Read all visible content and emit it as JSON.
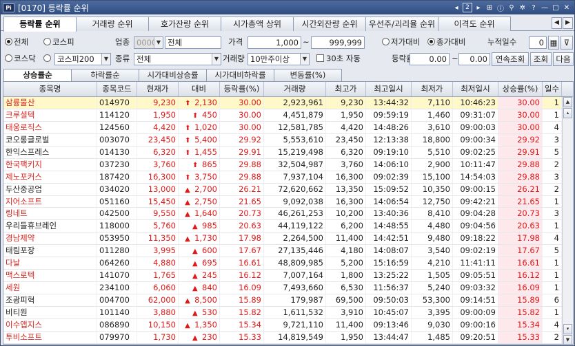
{
  "window": {
    "code_bracket": "[0170]",
    "title": "등락률 순위",
    "logo": "Pi",
    "page_num": "2"
  },
  "tabs": [
    "등락률 순위",
    "거래량 순위",
    "호가잔량 순위",
    "시가총액 상위",
    "시간외잔량 순위",
    "우선주/괴리율 순위",
    "이격도 순위"
  ],
  "filters": {
    "market_all": "전체",
    "kospi": "코스피",
    "kosdaq": "코스닥",
    "kospi200": "코스피200",
    "sector_label": "업종",
    "sector_code": "0000",
    "sector_value": "전체",
    "price_label": "가격",
    "price_min": "1,000",
    "price_sep": "~",
    "price_max": "999,999",
    "vs_low": "저가대비",
    "vs_close": "종가대비",
    "cum_days_label": "누적일수",
    "cum_days": "0",
    "type_label": "종류",
    "type_value": "전체",
    "volume_label": "거래량",
    "volume_value": "10만주이상",
    "auto_label": "30초 자동",
    "rate_label": "등락률",
    "rate_min": "0.00",
    "rate_sep": "~",
    "rate_max": "0.00",
    "btn_continuous": "연속조회",
    "btn_query": "조회",
    "btn_next": "다음"
  },
  "subtabs": [
    "상승률순",
    "하락률순",
    "시가대비상승률",
    "시가대비하락률",
    "변동률(%)"
  ],
  "columns": [
    "종목명",
    "종목코드",
    "현재가",
    "대비",
    "등락률(%)",
    "거래량",
    "최고가",
    "최고일시",
    "최저가",
    "최저일시",
    "상승률(%)",
    "일수"
  ],
  "rows": [
    {
      "name": "삼륭물산",
      "code": "014970",
      "price": "9,230",
      "arrow": "⬆",
      "diff": "2,130",
      "rate": "30.00",
      "volume": "2,923,961",
      "high": "9,230",
      "high_time": "13:44:32",
      "low": "7,110",
      "low_time": "10:46:23",
      "up_rate": "30.00",
      "days": "1",
      "name_red": true,
      "sel": true
    },
    {
      "name": "크루셜텍",
      "code": "114120",
      "price": "1,950",
      "arrow": "⬆",
      "diff": "450",
      "rate": "30.00",
      "volume": "4,451,879",
      "high": "1,950",
      "high_time": "09:59:19",
      "low": "1,460",
      "low_time": "09:31:07",
      "up_rate": "30.00",
      "days": "1",
      "name_red": true
    },
    {
      "name": "태웅로직스",
      "code": "124560",
      "price": "4,420",
      "arrow": "⬆",
      "diff": "1,020",
      "rate": "30.00",
      "volume": "12,581,785",
      "high": "4,420",
      "high_time": "14:48:26",
      "low": "3,610",
      "low_time": "09:00:03",
      "up_rate": "30.00",
      "days": "4",
      "name_red": true
    },
    {
      "name": "코오롱글로벌",
      "code": "003070",
      "price": "23,450",
      "arrow": "⬆",
      "diff": "5,400",
      "rate": "29.92",
      "volume": "5,553,610",
      "high": "23,450",
      "high_time": "12:13:38",
      "low": "18,800",
      "low_time": "09:00:34",
      "up_rate": "29.92",
      "days": "3",
      "name_red": false
    },
    {
      "name": "한익스프레스",
      "code": "014130",
      "price": "6,320",
      "arrow": "⬆",
      "diff": "1,455",
      "rate": "29.91",
      "volume": "15,219,498",
      "high": "6,320",
      "high_time": "09:19:10",
      "low": "5,510",
      "low_time": "09:02:25",
      "up_rate": "29.91",
      "days": "5",
      "name_red": false
    },
    {
      "name": "한국팩키지",
      "code": "037230",
      "price": "3,760",
      "arrow": "⬆",
      "diff": "865",
      "rate": "29.88",
      "volume": "32,504,987",
      "high": "3,760",
      "high_time": "14:06:10",
      "low": "2,900",
      "low_time": "10:11:47",
      "up_rate": "29.88",
      "days": "2",
      "name_red": true
    },
    {
      "name": "제노포커스",
      "code": "187420",
      "price": "16,300",
      "arrow": "⬆",
      "diff": "3,750",
      "rate": "29.88",
      "volume": "7,937,104",
      "high": "16,300",
      "high_time": "09:02:39",
      "low": "15,100",
      "low_time": "14:54:03",
      "up_rate": "29.88",
      "days": "3",
      "name_red": true
    },
    {
      "name": "두산중공업",
      "code": "034020",
      "price": "13,000",
      "arrow": "▲",
      "diff": "2,700",
      "rate": "26.21",
      "volume": "72,620,662",
      "high": "13,350",
      "high_time": "15:09:52",
      "low": "10,350",
      "low_time": "09:00:15",
      "up_rate": "26.21",
      "days": "2",
      "name_red": false
    },
    {
      "name": "지어소프트",
      "code": "051160",
      "price": "15,450",
      "arrow": "▲",
      "diff": "2,750",
      "rate": "21.65",
      "volume": "9,092,038",
      "high": "16,300",
      "high_time": "14:06:54",
      "low": "12,750",
      "low_time": "09:42:21",
      "up_rate": "21.65",
      "days": "1",
      "name_red": true
    },
    {
      "name": "링네트",
      "code": "042500",
      "price": "9,550",
      "arrow": "▲",
      "diff": "1,640",
      "rate": "20.73",
      "volume": "46,261,253",
      "high": "10,200",
      "high_time": "13:40:36",
      "low": "8,410",
      "low_time": "09:04:28",
      "up_rate": "20.73",
      "days": "3",
      "name_red": true
    },
    {
      "name": "우리들휴브레인",
      "code": "118000",
      "price": "5,760",
      "arrow": "▲",
      "diff": "985",
      "rate": "20.63",
      "volume": "44,119,122",
      "high": "6,200",
      "high_time": "14:48:55",
      "low": "4,480",
      "low_time": "09:04:56",
      "up_rate": "20.63",
      "days": "1",
      "name_red": false
    },
    {
      "name": "경남제약",
      "code": "053950",
      "price": "11,350",
      "arrow": "▲",
      "diff": "1,730",
      "rate": "17.98",
      "volume": "2,264,500",
      "high": "11,400",
      "high_time": "14:42:51",
      "low": "9,480",
      "low_time": "09:18:22",
      "up_rate": "17.98",
      "days": "4",
      "name_red": true
    },
    {
      "name": "태림포장",
      "code": "011280",
      "price": "3,995",
      "arrow": "▲",
      "diff": "600",
      "rate": "17.67",
      "volume": "27,135,446",
      "high": "4,180",
      "high_time": "14:08:07",
      "low": "3,540",
      "low_time": "09:02:19",
      "up_rate": "17.67",
      "days": "5",
      "name_red": false
    },
    {
      "name": "다날",
      "code": "064260",
      "price": "4,880",
      "arrow": "▲",
      "diff": "695",
      "rate": "16.61",
      "volume": "48,809,985",
      "high": "5,200",
      "high_time": "15:16:59",
      "low": "4,210",
      "low_time": "11:41:11",
      "up_rate": "16.61",
      "days": "1",
      "name_red": true
    },
    {
      "name": "맥스로텍",
      "code": "141070",
      "price": "1,765",
      "arrow": "▲",
      "diff": "245",
      "rate": "16.12",
      "volume": "7,007,164",
      "high": "1,800",
      "high_time": "13:25:22",
      "low": "1,505",
      "low_time": "09:05:51",
      "up_rate": "16.12",
      "days": "1",
      "name_red": true
    },
    {
      "name": "세원",
      "code": "234100",
      "price": "6,060",
      "arrow": "▲",
      "diff": "840",
      "rate": "16.09",
      "volume": "7,493,660",
      "high": "6,530",
      "high_time": "11:56:37",
      "low": "5,240",
      "low_time": "09:03:32",
      "up_rate": "16.09",
      "days": "1",
      "name_red": true
    },
    {
      "name": "조광피혁",
      "code": "004700",
      "price": "62,000",
      "arrow": "▲",
      "diff": "8,500",
      "rate": "15.89",
      "volume": "179,987",
      "high": "69,500",
      "high_time": "09:50:03",
      "low": "53,300",
      "low_time": "09:14:51",
      "up_rate": "15.89",
      "days": "6",
      "name_red": false
    },
    {
      "name": "비티원",
      "code": "101140",
      "price": "3,880",
      "arrow": "▲",
      "diff": "530",
      "rate": "15.82",
      "volume": "1,611,532",
      "high": "3,910",
      "high_time": "10:45:07",
      "low": "3,395",
      "low_time": "09:00:09",
      "up_rate": "15.82",
      "days": "1",
      "name_red": false
    },
    {
      "name": "이수앱지스",
      "code": "086890",
      "price": "10,150",
      "arrow": "▲",
      "diff": "1,350",
      "rate": "15.34",
      "volume": "9,721,110",
      "high": "11,400",
      "high_time": "09:13:46",
      "low": "9,030",
      "low_time": "09:00:16",
      "up_rate": "15.34",
      "days": "4",
      "name_red": true
    },
    {
      "name": "투비소프트",
      "code": "079970",
      "price": "1,730",
      "arrow": "▲",
      "diff": "230",
      "rate": "15.33",
      "volume": "14,819,549",
      "high": "1,950",
      "high_time": "13:44:47",
      "low": "1,485",
      "low_time": "09:20:51",
      "up_rate": "15.33",
      "days": "2",
      "name_red": true
    }
  ]
}
